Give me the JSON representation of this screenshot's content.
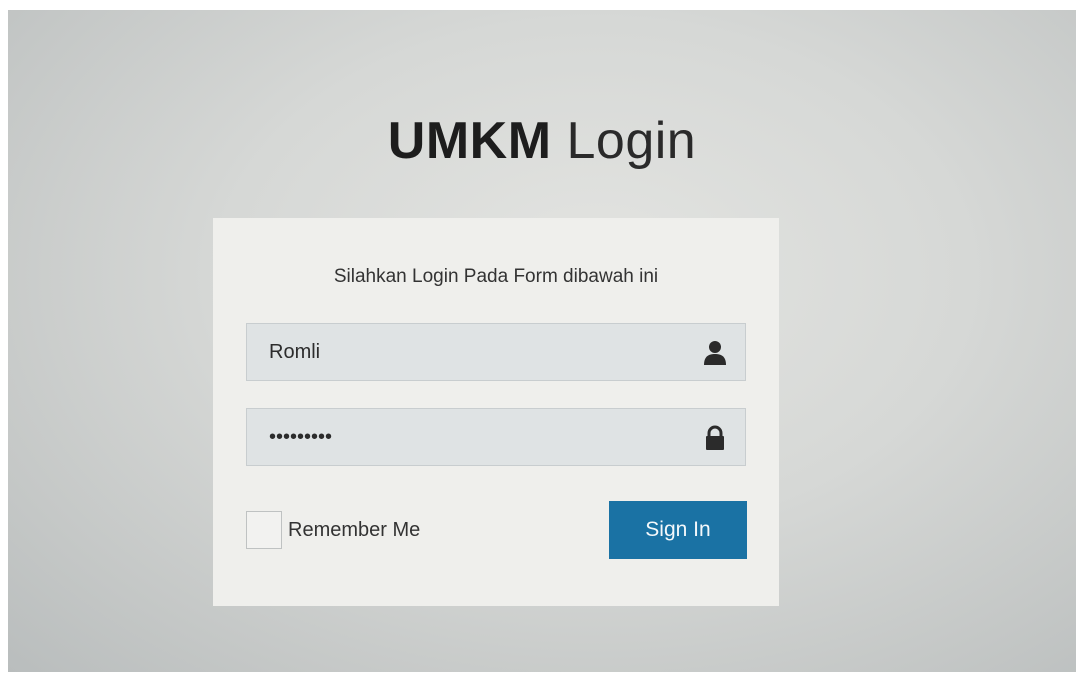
{
  "brand": {
    "bold": "UMKM",
    "light": "Login"
  },
  "login": {
    "message": "Silahkan Login Pada Form dibawah ini",
    "username": {
      "value": "Romli",
      "icon": "user-icon"
    },
    "password": {
      "value": "123456789",
      "icon": "lock-icon"
    },
    "remember_label": "Remember Me",
    "remember_checked": false,
    "signin_label": "Sign In"
  },
  "colors": {
    "button": "#1a72a4",
    "panel": "#efefec",
    "input": "#dfe3e4"
  }
}
